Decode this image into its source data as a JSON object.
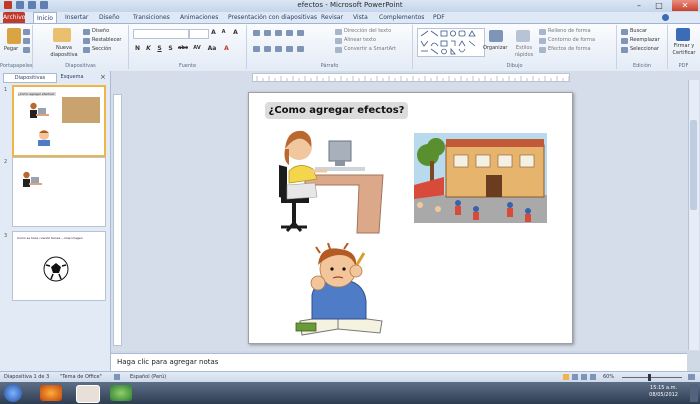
{
  "window": {
    "title": "efectos - Microsoft PowerPoint",
    "minimize": "–",
    "maximize": "□",
    "close": "✕"
  },
  "tabs": [
    "Archivo",
    "Inicio",
    "Insertar",
    "Diseño",
    "Transiciones",
    "Animaciones",
    "Presentación con diapositivas",
    "Revisar",
    "Vista",
    "Complementos",
    "PDF"
  ],
  "ribbon": {
    "portapapeles": {
      "paste": "Pegar",
      "label": "Portapapeles"
    },
    "diapositivas": {
      "new_slide": "Nueva diapositiva",
      "design": "Diseño",
      "reset": "Restablecer",
      "section": "Sección",
      "label": "Diapositivas"
    },
    "fuente": {
      "bold": "N",
      "italic": "K",
      "underline": "S",
      "shadow": "S",
      "strike": "abc",
      "spacing": "AV",
      "case": "Aa",
      "color": "A",
      "grow": "A",
      "shrink": "A",
      "clear": "A",
      "label": "Fuente"
    },
    "parrafo": {
      "direction": "Dirección del texto",
      "align": "Alinear texto",
      "smartart": "Convertir a SmartArt",
      "label": "Párrafo"
    },
    "dibujo": {
      "arrange": "Organizar",
      "quick_styles": "Estilos rápidos",
      "fill": "Relleno de forma",
      "outline": "Contorno de forma",
      "effects": "Efectos de forma",
      "label": "Dibujo"
    },
    "edicion": {
      "find": "Buscar",
      "replace": "Reemplazar",
      "select": "Seleccionar",
      "label": "Edición"
    },
    "pdf": {
      "sign": "Firmar y Certificar",
      "label": "PDF"
    }
  },
  "left_panel": {
    "tab_slides": "Diapositivas",
    "tab_outline": "Esquema",
    "close": "×",
    "thumbnails": [
      {
        "number": "1",
        "title": "¿Como agregar efectos?"
      },
      {
        "number": "2",
        "title": ""
      },
      {
        "number": "3",
        "title": "Como se hace cuando tienes ...mas imagen"
      }
    ]
  },
  "slide": {
    "title": "¿Como agregar efectos?"
  },
  "notes": {
    "placeholder": "Haga clic para agregar notas"
  },
  "status": {
    "slide": "Diapositiva 1 de 3",
    "theme": "\"Tema de Office\"",
    "language": "Español (Perú)",
    "zoom": "60%"
  },
  "taskbar": {
    "time": "15:15 a.m.",
    "date": "08/05/2012"
  },
  "colors": {
    "accent_file_tab": "#c0392b",
    "selected_thumb": "#f0b548",
    "ribbon_bg": "#e3ebf6",
    "taskbar": "#2f3d52"
  }
}
